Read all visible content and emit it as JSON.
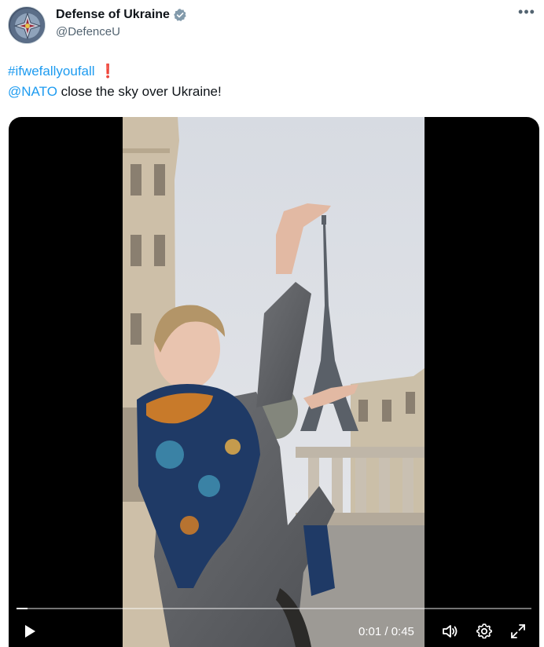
{
  "author": {
    "display_name": "Defense of Ukraine",
    "handle": "@DefenceU",
    "verified": true,
    "verified_color": "#829aab"
  },
  "tweet": {
    "hashtag": "#ifwefallyoufall",
    "emoji": "❗",
    "mention": "@NATO",
    "text_rest": " close the sky over Ukraine!"
  },
  "video": {
    "current_time": "0:01",
    "duration": "0:45",
    "time_display": "0:01 / 0:45",
    "progress": 0.022,
    "icons": [
      "play-icon",
      "volume-icon",
      "settings-icon",
      "fullscreen-icon"
    ]
  },
  "colors": {
    "link": "#1d9bf0",
    "secondary_text": "#536471"
  }
}
